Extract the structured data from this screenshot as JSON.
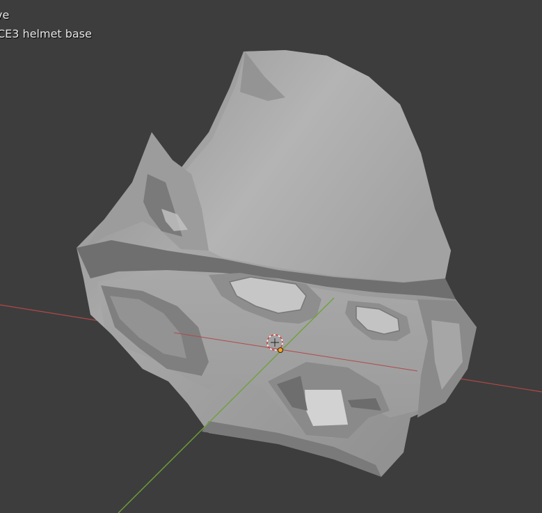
{
  "viewport": {
    "overlay": {
      "mode_text": "ve",
      "object_text": "CE3 helmet base"
    },
    "colors": {
      "background": "#3d3d3d",
      "x_axis": "#b34848",
      "y_axis": "#6da23a",
      "origin": "#f5a623"
    },
    "icons": {
      "origin_marker": "origin-dot-icon",
      "cursor_3d": "3d-cursor-icon"
    }
  }
}
